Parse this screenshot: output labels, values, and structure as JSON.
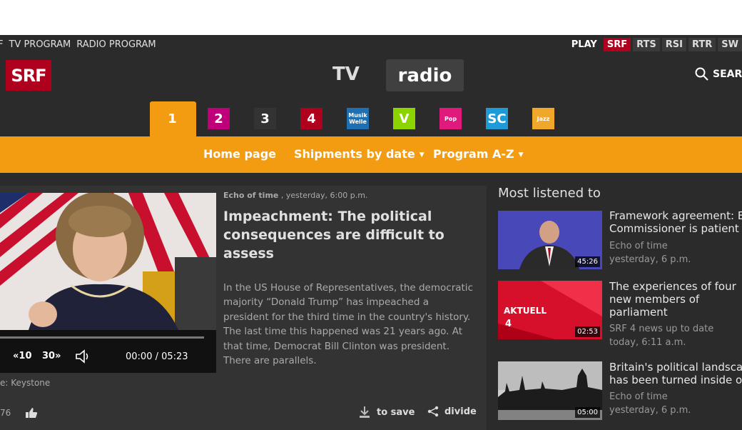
{
  "topnav": {
    "cut_prefix": "F",
    "items": [
      "TV PROGRAM",
      "RADIO PROGRAM"
    ]
  },
  "units": {
    "play": "PLAY",
    "items": [
      "SRF",
      "RTS",
      "RSI",
      "RTR",
      "SW"
    ]
  },
  "logo": "SRF",
  "header": {
    "tv": "TV",
    "radio": "radio",
    "search": "SEARC"
  },
  "channels": [
    {
      "icon": "srf1-icon",
      "label": "1",
      "color": "#f39c12"
    },
    {
      "icon": "srf2-kultur-icon",
      "label": "2",
      "color": "#c0007a"
    },
    {
      "icon": "srf3-icon",
      "label": "3",
      "color": "#333333"
    },
    {
      "icon": "srf4-news-icon",
      "label": "4",
      "color": "#af001e"
    },
    {
      "icon": "musikwelle-icon",
      "label": "Musik Welle",
      "color": "#1f6fb3"
    },
    {
      "icon": "virus-icon",
      "label": "V",
      "color": "#8bd400"
    },
    {
      "icon": "pop-icon",
      "label": "Pop",
      "color": "#e0197d"
    },
    {
      "icon": "swiss-classic-icon",
      "label": "SC",
      "color": "#1e9ad6"
    },
    {
      "icon": "swiss-jazz-icon",
      "label": "Jazz",
      "color": "#f0a82a"
    }
  ],
  "subnav": {
    "home": "Home page",
    "shipments": "Shipments by date",
    "program": "Program A-Z"
  },
  "article": {
    "show": "Echo of time",
    "time": " , yesterday, 6:00 p.m.",
    "headline": "Impeachment: The political consequences are difficult to assess",
    "body": "In the US House of Representatives, the democratic majority “Donald Trump” has impeached a president for the third time in the country's history. The last time this happened was 21 years ago. At that time, Democrat Bill Clinton was president. There are parallels.",
    "credit": "e: Keystone",
    "likes": "76",
    "save": "to save",
    "share": "divide"
  },
  "player": {
    "rewind": "10",
    "forward": "30",
    "time": "00:00 / 05:23",
    "progress": 0
  },
  "sidebar": {
    "title": "Most listened to",
    "items": [
      {
        "title1": "Framework agreement: E",
        "title2": "Commissioner is patient",
        "title3": "",
        "show": "Echo of time",
        "time": "yesterday, 6 p.m.",
        "duration": "45:26"
      },
      {
        "title1": "The experiences of four",
        "title2": "new members of",
        "title3": "parliament",
        "show": "SRF 4 news up to date",
        "time": "today, 6:11 a.m.",
        "duration": "02:53",
        "thumb_text": "AKTUELL"
      },
      {
        "title1": "Britain's political landscap",
        "title2": "has been turned inside ou",
        "title3": "",
        "show": "Echo of time",
        "time": "yesterday, 6 p.m.",
        "duration": "05:00"
      }
    ]
  }
}
